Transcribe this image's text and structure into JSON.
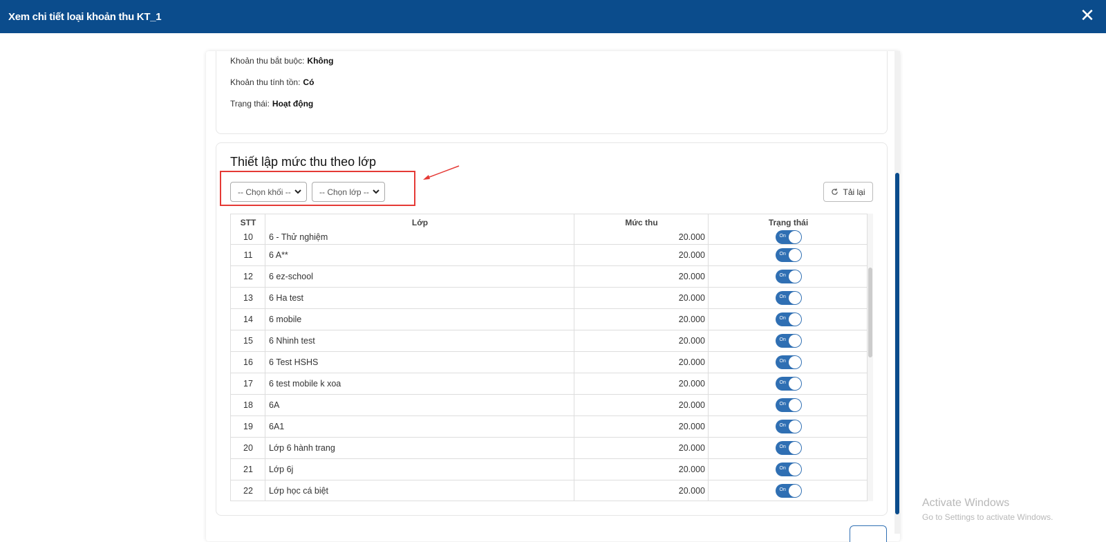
{
  "window": {
    "title": "Xem chi tiết loại khoản thu KT_1",
    "close_symbol": "✕"
  },
  "info": [
    {
      "label": "Khoản thu bắt buộc:",
      "value": "Không"
    },
    {
      "label": "Khoản thu tính tồn:",
      "value": "Có"
    },
    {
      "label": "Trạng thái:",
      "value": "Hoạt động"
    }
  ],
  "settings": {
    "title": "Thiết lập mức thu theo lớp",
    "filter_grade": "-- Chọn khối --",
    "filter_class": "-- Chọn lớp --",
    "reload_label": "Tải lại"
  },
  "table": {
    "headers": {
      "stt": "STT",
      "lop": "Lớp",
      "muc_thu": "Mức thu",
      "trang_thai": "Trạng thái"
    },
    "toggle_label": "On",
    "rows": [
      {
        "stt": "10",
        "lop": "6 - Thử nghiệm",
        "muc_thu": "20.000"
      },
      {
        "stt": "11",
        "lop": "6 A**",
        "muc_thu": "20.000"
      },
      {
        "stt": "12",
        "lop": "6 ez-school",
        "muc_thu": "20.000"
      },
      {
        "stt": "13",
        "lop": "6 Ha test",
        "muc_thu": "20.000"
      },
      {
        "stt": "14",
        "lop": "6 mobile",
        "muc_thu": "20.000"
      },
      {
        "stt": "15",
        "lop": "6 Nhinh test",
        "muc_thu": "20.000"
      },
      {
        "stt": "16",
        "lop": "6 Test HSHS",
        "muc_thu": "20.000"
      },
      {
        "stt": "17",
        "lop": "6 test mobile k xoa",
        "muc_thu": "20.000"
      },
      {
        "stt": "18",
        "lop": "6A",
        "muc_thu": "20.000"
      },
      {
        "stt": "19",
        "lop": "6A1",
        "muc_thu": "20.000"
      },
      {
        "stt": "20",
        "lop": "Lớp 6 hành trang",
        "muc_thu": "20.000"
      },
      {
        "stt": "21",
        "lop": "Lớp 6j",
        "muc_thu": "20.000"
      },
      {
        "stt": "22",
        "lop": "Lớp học cá biệt",
        "muc_thu": "20.000"
      }
    ]
  },
  "watermark": {
    "line1": "Activate Windows",
    "line2": "Go to Settings to activate Windows."
  }
}
